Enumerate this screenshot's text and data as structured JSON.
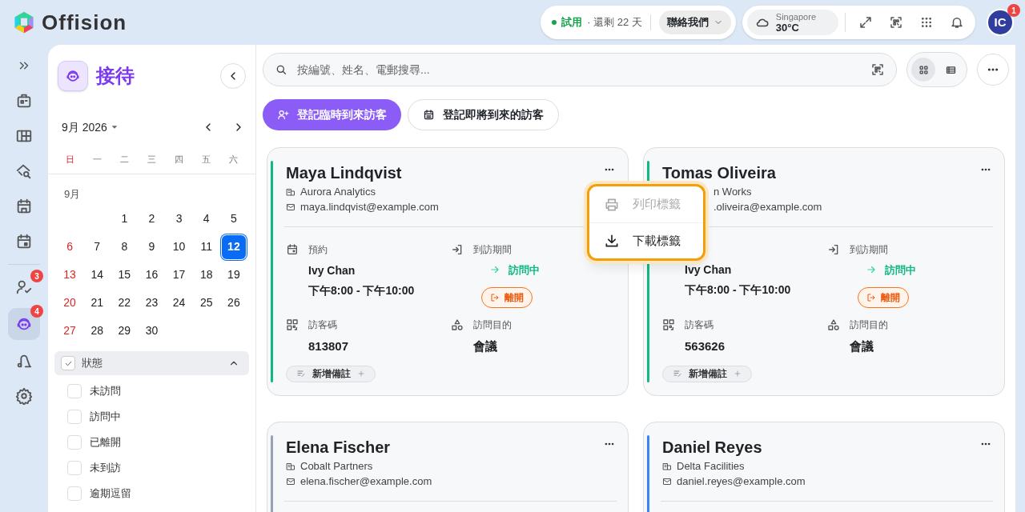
{
  "app": {
    "name": "Offision"
  },
  "top_bar": {
    "trial_label": "試用",
    "trial_remaining": "· 還剩 22 天",
    "contact_button": "聯絡我們",
    "weather_city": "Singapore",
    "weather_temp": "30°C",
    "avatar_initials": "IC",
    "notification_count": "1"
  },
  "rail": [
    {
      "kind": "expand",
      "selected": false
    },
    {
      "kind": "building",
      "selected": false
    },
    {
      "kind": "grid",
      "selected": false
    },
    {
      "kind": "search-home",
      "selected": false
    },
    {
      "kind": "calendar",
      "selected": false
    },
    {
      "kind": "calendar-dot",
      "selected": false
    },
    {
      "kind": "person-check",
      "selected": false,
      "badge": "3"
    },
    {
      "kind": "reception",
      "selected": true,
      "badge": "4"
    },
    {
      "kind": "vacuum",
      "selected": false
    },
    {
      "kind": "settings",
      "selected": false
    }
  ],
  "sidebar": {
    "title": "接待",
    "calendar": {
      "month_label": "9月 2026",
      "section_label": "9月",
      "weekdays": [
        {
          "label": "日",
          "weekend": true
        },
        {
          "label": "一",
          "weekend": false
        },
        {
          "label": "二",
          "weekend": false
        },
        {
          "label": "三",
          "weekend": false
        },
        {
          "label": "四",
          "weekend": false
        },
        {
          "label": "五",
          "weekend": false
        },
        {
          "label": "六",
          "weekend": false
        }
      ],
      "weeks": [
        {
          "kind": "first",
          "days": [
            {
              "label": "1",
              "weekend": false,
              "selected": false
            },
            {
              "label": "2",
              "weekend": false,
              "selected": false
            },
            {
              "label": "3",
              "weekend": false,
              "selected": false
            },
            {
              "label": "4",
              "weekend": false,
              "selected": false
            },
            {
              "label": "5",
              "weekend": false,
              "selected": false
            }
          ]
        },
        {
          "kind": "full",
          "days": [
            {
              "label": "6",
              "weekend": true,
              "selected": false
            },
            {
              "label": "7",
              "weekend": false,
              "selected": false
            },
            {
              "label": "8",
              "weekend": false,
              "selected": false
            },
            {
              "label": "9",
              "weekend": false,
              "selected": false
            },
            {
              "label": "10",
              "weekend": false,
              "selected": false
            },
            {
              "label": "11",
              "weekend": false,
              "selected": false
            },
            {
              "label": "12",
              "weekend": false,
              "selected": true
            }
          ]
        },
        {
          "kind": "full",
          "days": [
            {
              "label": "13",
              "weekend": true,
              "selected": false
            },
            {
              "label": "14",
              "weekend": false,
              "selected": false
            },
            {
              "label": "15",
              "weekend": false,
              "selected": false
            },
            {
              "label": "16",
              "weekend": false,
              "selected": false
            },
            {
              "label": "17",
              "weekend": false,
              "selected": false
            },
            {
              "label": "18",
              "weekend": false,
              "selected": false
            },
            {
              "label": "19",
              "weekend": false,
              "selected": false
            }
          ]
        },
        {
          "kind": "full",
          "days": [
            {
              "label": "20",
              "weekend": true,
              "selected": false
            },
            {
              "label": "21",
              "weekend": false,
              "selected": false
            },
            {
              "label": "22",
              "weekend": false,
              "selected": false
            },
            {
              "label": "23",
              "weekend": false,
              "selected": false
            },
            {
              "label": "24",
              "weekend": false,
              "selected": false
            },
            {
              "label": "25",
              "weekend": false,
              "selected": false
            },
            {
              "label": "26",
              "weekend": false,
              "selected": false
            }
          ]
        },
        {
          "kind": "last",
          "days": [
            {
              "label": "27",
              "weekend": true,
              "selected": false
            },
            {
              "label": "28",
              "weekend": false,
              "selected": false
            },
            {
              "label": "29",
              "weekend": false,
              "selected": false
            },
            {
              "label": "30",
              "weekend": false,
              "selected": false
            }
          ]
        }
      ]
    },
    "status_filter": {
      "label": "狀態",
      "checked": true,
      "expanded": true,
      "options": [
        {
          "label": "未訪問",
          "checked": false
        },
        {
          "label": "訪問中",
          "checked": false
        },
        {
          "label": "已離開",
          "checked": false
        },
        {
          "label": "未到訪",
          "checked": false
        },
        {
          "label": "逾期逗留",
          "checked": false
        }
      ]
    }
  },
  "search": {
    "placeholder": "按編號、姓名、電郵搜尋..."
  },
  "view_toggle": [
    {
      "kind": "grid",
      "selected": true
    },
    {
      "kind": "list",
      "selected": false
    }
  ],
  "actions": [
    {
      "kind": "primary",
      "label": "登記臨時到來訪客"
    },
    {
      "kind": "secondary",
      "label": "登記即將到來的訪客"
    }
  ],
  "cards": [
    {
      "name": "Maya Lindqvist",
      "company": "Aurora Analytics",
      "email": "maya.lindqvist@example.com",
      "color": "#10b981",
      "covered": false,
      "details": {
        "booking_label": "預約",
        "host": "Ivy Chan",
        "time": "下午8:00 - 下午10:00",
        "visit_label": "到訪期間",
        "status": "訪問中",
        "leave_button": "離開",
        "code_label": "訪客碼",
        "code": "813807",
        "purpose_label": "訪問目的",
        "purpose": "會議",
        "note_button": "新增備註"
      }
    },
    {
      "name": "Tomas Oliveira",
      "company": "n Works",
      "email": ".oliveira@example.com",
      "color": "#10b981",
      "covered": true,
      "details": {
        "host": "Ivy Chan",
        "time": "下午8:00 - 下午10:00",
        "visit_label": "到訪期間",
        "status": "訪問中",
        "leave_button": "離開",
        "code_label": "訪客碼",
        "code": "563626",
        "purpose_label": "訪問目的",
        "purpose": "會議",
        "note_button": "新增備註"
      }
    },
    {
      "name": "Elena Fischer",
      "company": "Cobalt Partners",
      "email": "elena.fischer@example.com",
      "color": "#94a3b8",
      "covered": false
    },
    {
      "name": "Daniel Reyes",
      "company": "Delta Facilities",
      "email": "daniel.reyes@example.com",
      "color": "#3b82f6",
      "covered": false
    }
  ],
  "card_menu": {
    "items": [
      {
        "kind": "print",
        "label": "列印標籤",
        "disabled": true
      },
      {
        "kind": "download",
        "label": "下載標籤",
        "disabled": false
      }
    ]
  }
}
